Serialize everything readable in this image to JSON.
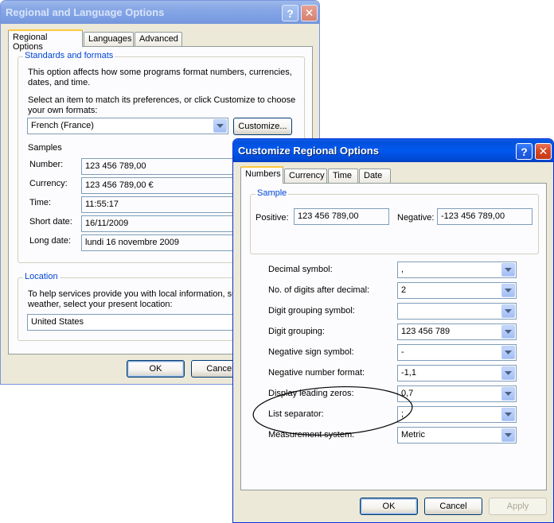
{
  "back_window": {
    "title": "Regional and Language Options",
    "help_label": "?",
    "close_label": "✕",
    "tabs": [
      "Regional Options",
      "Languages",
      "Advanced"
    ],
    "standards": {
      "group_label": "Standards and formats",
      "desc1": "This option affects how some programs format numbers, currencies,",
      "desc1b": "dates, and time.",
      "desc2": "Select an item to match its preferences, or click Customize to choose",
      "desc2b": "your own formats:",
      "locale_value": "French (France)",
      "customize_label": "Customize...",
      "samples_label": "Samples",
      "samples": [
        {
          "label": "Number:",
          "value": "123 456 789,00"
        },
        {
          "label": "Currency:",
          "value": "123 456 789,00 €"
        },
        {
          "label": "Time:",
          "value": "11:55:17"
        },
        {
          "label": "Short date:",
          "value": "16/11/2009"
        },
        {
          "label": "Long date:",
          "value": "lundi 16 novembre 2009"
        }
      ]
    },
    "location": {
      "group_label": "Location",
      "desc1": "To help services provide you with local information, suc",
      "desc2": "weather, select your present location:",
      "value": "United States"
    },
    "ok_label": "OK",
    "cancel_label": "Cancel"
  },
  "front_window": {
    "title": "Customize Regional Options",
    "help_label": "?",
    "close_label": "✕",
    "tabs": [
      "Numbers",
      "Currency",
      "Time",
      "Date"
    ],
    "sample": {
      "group_label": "Sample",
      "positive_label": "Positive:",
      "positive_value": "123 456 789,00",
      "negative_label": "Negative:",
      "negative_value": "-123 456 789,00"
    },
    "settings": [
      {
        "label": "Decimal symbol:",
        "value": ","
      },
      {
        "label": "No. of digits after decimal:",
        "value": "2"
      },
      {
        "label": "Digit grouping symbol:",
        "value": ""
      },
      {
        "label": "Digit grouping:",
        "value": "123 456 789"
      },
      {
        "label": "Negative sign symbol:",
        "value": "-"
      },
      {
        "label": "Negative number format:",
        "value": "-1,1"
      },
      {
        "label": "Display leading zeros:",
        "value": "0,7"
      },
      {
        "label": "List separator:",
        "value": ";"
      },
      {
        "label": "Measurement system:",
        "value": "Metric"
      }
    ],
    "ok_label": "OK",
    "cancel_label": "Cancel",
    "apply_label": "Apply"
  },
  "colors": {
    "title_active": "#0058ee",
    "group_label": "#0046d5",
    "annotation": "#000000"
  }
}
